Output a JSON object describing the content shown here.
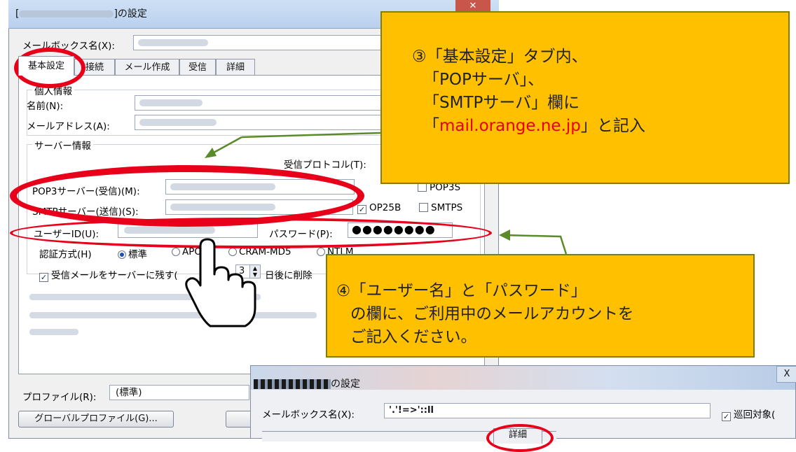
{
  "dialog1": {
    "title_suffix": "]の設定",
    "title_prefix": "[",
    "mailbox_label": "メールボックス名(X):",
    "tabs": [
      "基本設定",
      "接続",
      "メール作成",
      "受信",
      "詳細"
    ],
    "personal_group": "個人情報",
    "name_label": "名前(N):",
    "address_label": "メールアドレス(A):",
    "server_group": "サーバー情報",
    "protocol_label": "受信プロトコル(T):",
    "pop3_label": "POP3サーバー(受信)(M):",
    "smtp_label": "SMTPサーバー(送信)(S):",
    "op25b_label": "OP25B",
    "pop3s_label": "POP3S",
    "smtps_label": "SMTPS",
    "userid_label": "ユーザーID(U):",
    "password_label": "パスワード(P):",
    "password_value": "●●●●●●●●",
    "auth_label": "認証方式(H)",
    "auth_options": [
      "標準",
      "APOP",
      "CRAM-MD5",
      "NTLM"
    ],
    "leave_mail_label": "受信メールをサーバーに残す(",
    "days_value": "3",
    "days_suffix": "日後に削除",
    "profile_label": "プロファイル(R):",
    "profile_value": "(標準)",
    "global_profile_button": "グローバルプロファイル(G)..."
  },
  "dialog2": {
    "title": "の設定",
    "mailbox_label": "メールボックス名(X):",
    "mailbox_value": "'.'!=>'::ll",
    "patrol_label": "巡回対象(",
    "close_glyph": "X",
    "tab_detail": "詳細"
  },
  "callout3": {
    "lines": [
      "③「基本設定」タブ内、",
      "「POPサーバ」、",
      "「SMTPサーバ」欄に"
    ],
    "last_open": "「",
    "last_highlight": "mail.orange.ne.jp",
    "last_close": "」と記入"
  },
  "callout4": {
    "lines": [
      "④「ユーザー名」と「パスワード」",
      "の欄に、ご利用中のメールアカウントを",
      "ご記入ください。"
    ]
  },
  "colors": {
    "callout_fill": "#ffc000",
    "highlight_red": "#e8001a",
    "arrow_green": "#5a8a2a"
  },
  "icons": [
    "hand-pointer-icon",
    "checkbox-checked-icon",
    "radio-selected-icon",
    "spinner-icon"
  ]
}
